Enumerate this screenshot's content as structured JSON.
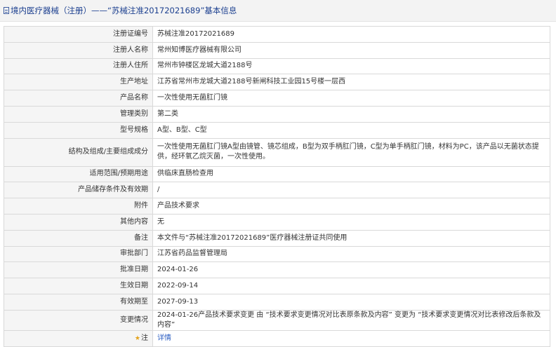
{
  "header": {
    "title": "境内医疗器械（注册）——“苏械注准20172021689”基本信息"
  },
  "rows": [
    {
      "label": "注册证编号",
      "value": "苏械注准20172021689"
    },
    {
      "label": "注册人名称",
      "value": "常州知博医疗器械有限公司"
    },
    {
      "label": "注册人住所",
      "value": "常州市钟楼区龙城大道2188号"
    },
    {
      "label": "生产地址",
      "value": "江苏省常州市龙城大道2188号新闸科技工业园15号楼一层西"
    },
    {
      "label": "产品名称",
      "value": "一次性使用无菌肛门镜"
    },
    {
      "label": "管理类别",
      "value": "第二类"
    },
    {
      "label": "型号规格",
      "value": "A型、B型、C型"
    },
    {
      "label": "结构及组成/主要组成成分",
      "value": "一次性使用无菌肛门镜A型由镜管、镜芯组成，B型为双手柄肛门镜，C型为单手柄肛门镜，材料为PC，该产品以无菌状态提供，经环氧乙烷灭菌，一次性使用。"
    },
    {
      "label": "适用范围/预期用途",
      "value": "供临床直肠检查用"
    },
    {
      "label": "产品储存条件及有效期",
      "value": "/"
    },
    {
      "label": "附件",
      "value": "产品技术要求"
    },
    {
      "label": "其他内容",
      "value": "无"
    },
    {
      "label": "备注",
      "value": "本文件与“苏械注准20172021689”医疗器械注册证共同使用"
    },
    {
      "label": "审批部门",
      "value": "江苏省药品监督管理局"
    },
    {
      "label": "批准日期",
      "value": "2024-01-26"
    },
    {
      "label": "生效日期",
      "value": "2022-09-14"
    },
    {
      "label": "有效期至",
      "value": "2027-09-13"
    },
    {
      "label": "变更情况",
      "value": "2024-01-26产品技术要求变更 由 “技术要求变更情况对比表原条款及内容” 变更为 “技术要求变更情况对比表修改后条款及内容”"
    }
  ],
  "note_row": {
    "label": "注",
    "link": "详情",
    "icon": "note-icon",
    "icon_color": "#e3a21a"
  },
  "colors": {
    "title": "#1b3f8f",
    "label_bg": "#f5f5f5",
    "border": "#d9d9d9",
    "link": "#2a5cc2"
  }
}
